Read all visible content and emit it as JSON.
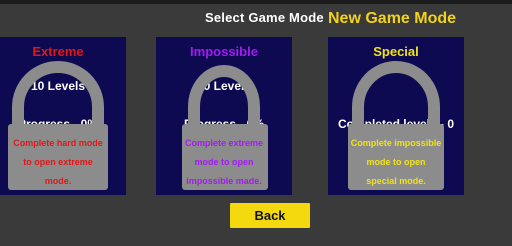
{
  "header": {
    "title": "Select Game Mode",
    "new_mode_label": "New Game Mode"
  },
  "colors": {
    "background": "#3a3a3a",
    "card": "#0d0a52",
    "lock_gray": "#8c8c8c",
    "extreme": "#e01818",
    "impossible": "#a21cf0",
    "special": "#f2e21b",
    "back_button": "#f5d90f"
  },
  "modes": [
    {
      "title": "Extreme",
      "levels_text": "10 Levels",
      "progress_text": "Progress - 0%",
      "locked": true,
      "lock_message": [
        "Complete hard mode",
        "to open extreme",
        "mode."
      ]
    },
    {
      "title": "Impossible",
      "levels_text": "10 Levels",
      "progress_text": "Progress - 0%",
      "locked": true,
      "lock_message": [
        "Complete extreme",
        "mode to open",
        "impossible made."
      ]
    },
    {
      "title": "Special",
      "levels_text": "",
      "progress_text": "Completed levels - 0",
      "locked": true,
      "lock_message": [
        "Complete impossible",
        "mode to open",
        "special mode."
      ]
    }
  ],
  "back_button": {
    "label": "Back"
  }
}
